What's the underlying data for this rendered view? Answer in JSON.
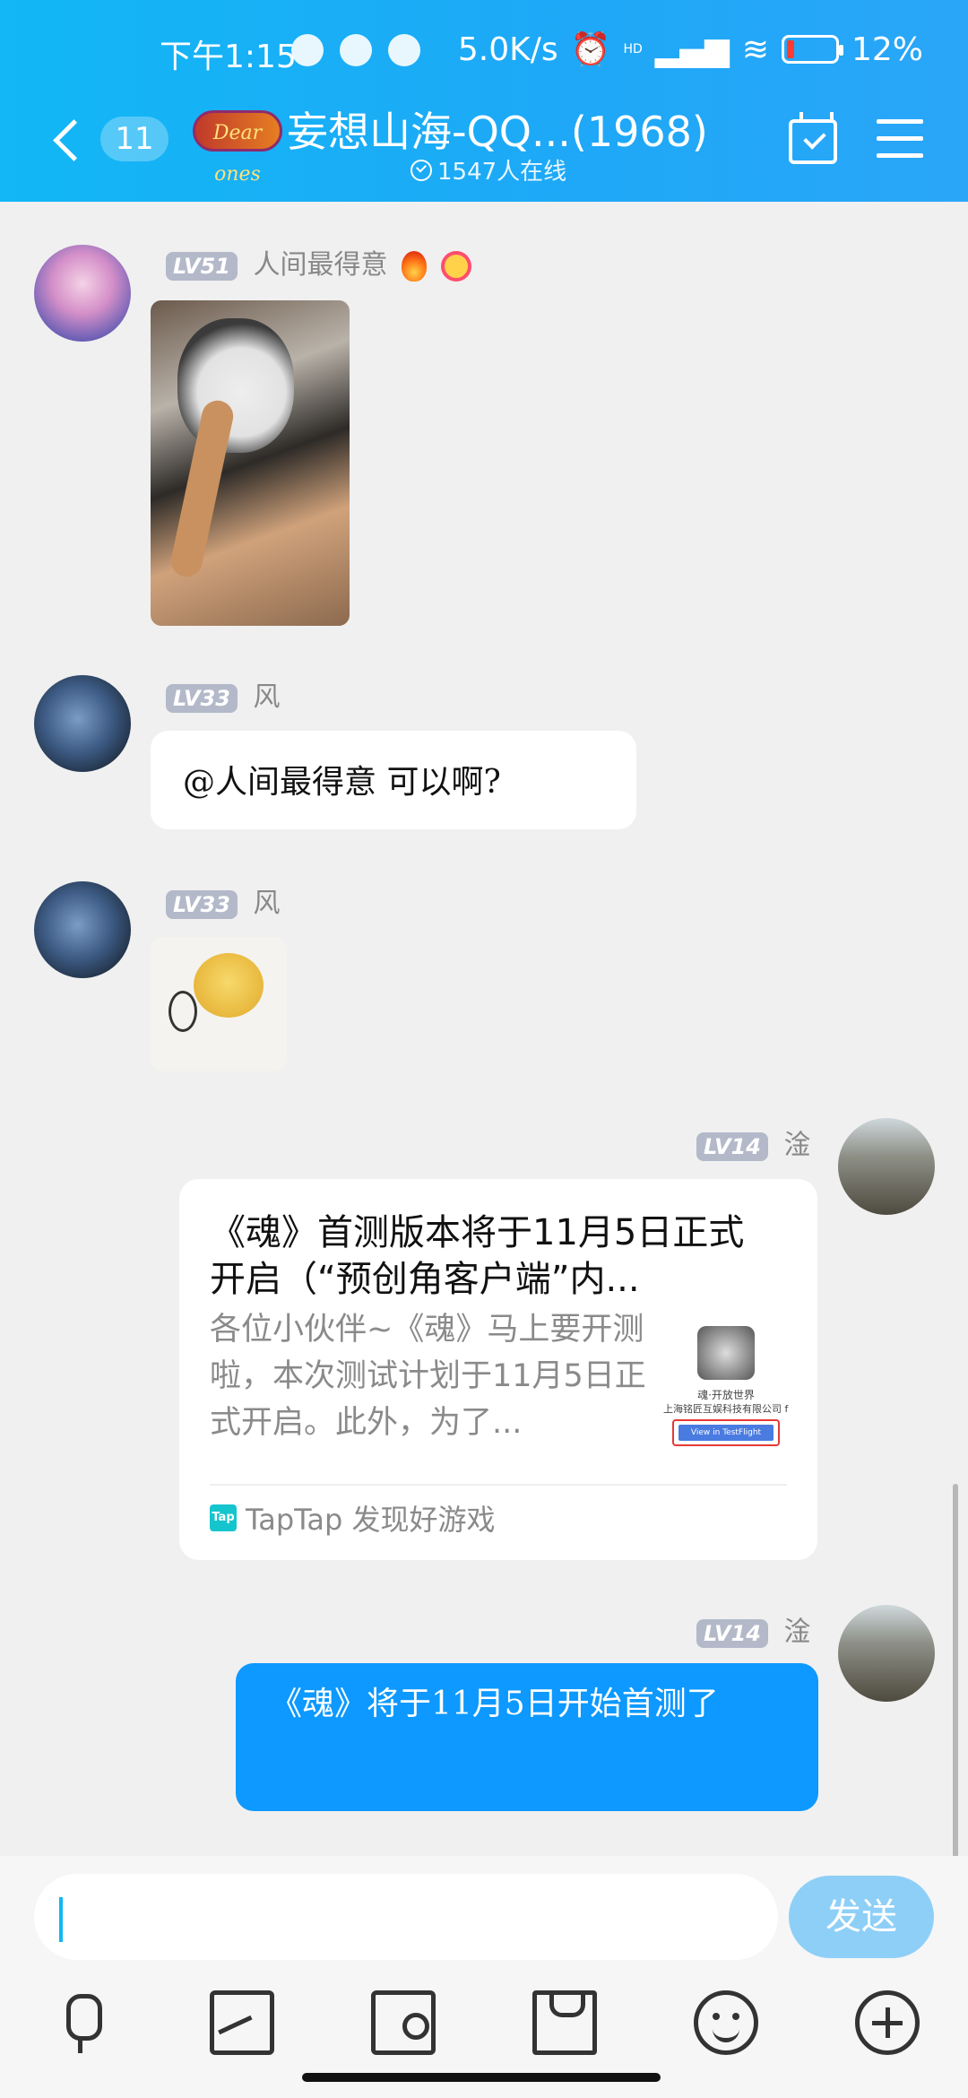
{
  "status_bar": {
    "time": "下午1:15",
    "network_speed": "5.0K/s",
    "hd_label": "HD",
    "battery": "12%",
    "battery_level": 0.12
  },
  "header": {
    "unread_count": "11",
    "group_logo_text": "Dear ones",
    "group_name": "妄想山海-QQ...(1968)",
    "online_count": "1547人在线"
  },
  "messages": [
    {
      "level": "LV51",
      "nickname": "人间最得意",
      "type": "image"
    },
    {
      "level": "LV33",
      "nickname": "风",
      "type": "text",
      "text": "@人间最得意 可以啊?"
    },
    {
      "level": "LV33",
      "nickname": "风",
      "type": "sticker"
    },
    {
      "level": "LV14",
      "nickname": "淦",
      "type": "card",
      "card": {
        "title": "《魂》首测版本将于11月5日正式开启（“预创角客户端”内...",
        "description": "各位小伙伴~《魂》马上要开测啦，本次测试计划于11月5日正式开启。此外，为了...",
        "thumb_line1": "魂·开放世界",
        "thumb_line2": "上海铭匠互娱科技有限公司 for iOS",
        "thumb_button": "View in TestFlight",
        "source_logo": "Tap",
        "source": "TapTap 发现好游戏"
      }
    },
    {
      "level": "LV14",
      "nickname": "淦",
      "type": "text",
      "text": "《魂》将于11月5日开始首测了"
    }
  ],
  "input": {
    "value": "",
    "send_label": "发送"
  },
  "icons": [
    "mic-icon",
    "image-icon",
    "camera-icon",
    "red-packet-icon",
    "emoji-icon",
    "plus-icon"
  ]
}
